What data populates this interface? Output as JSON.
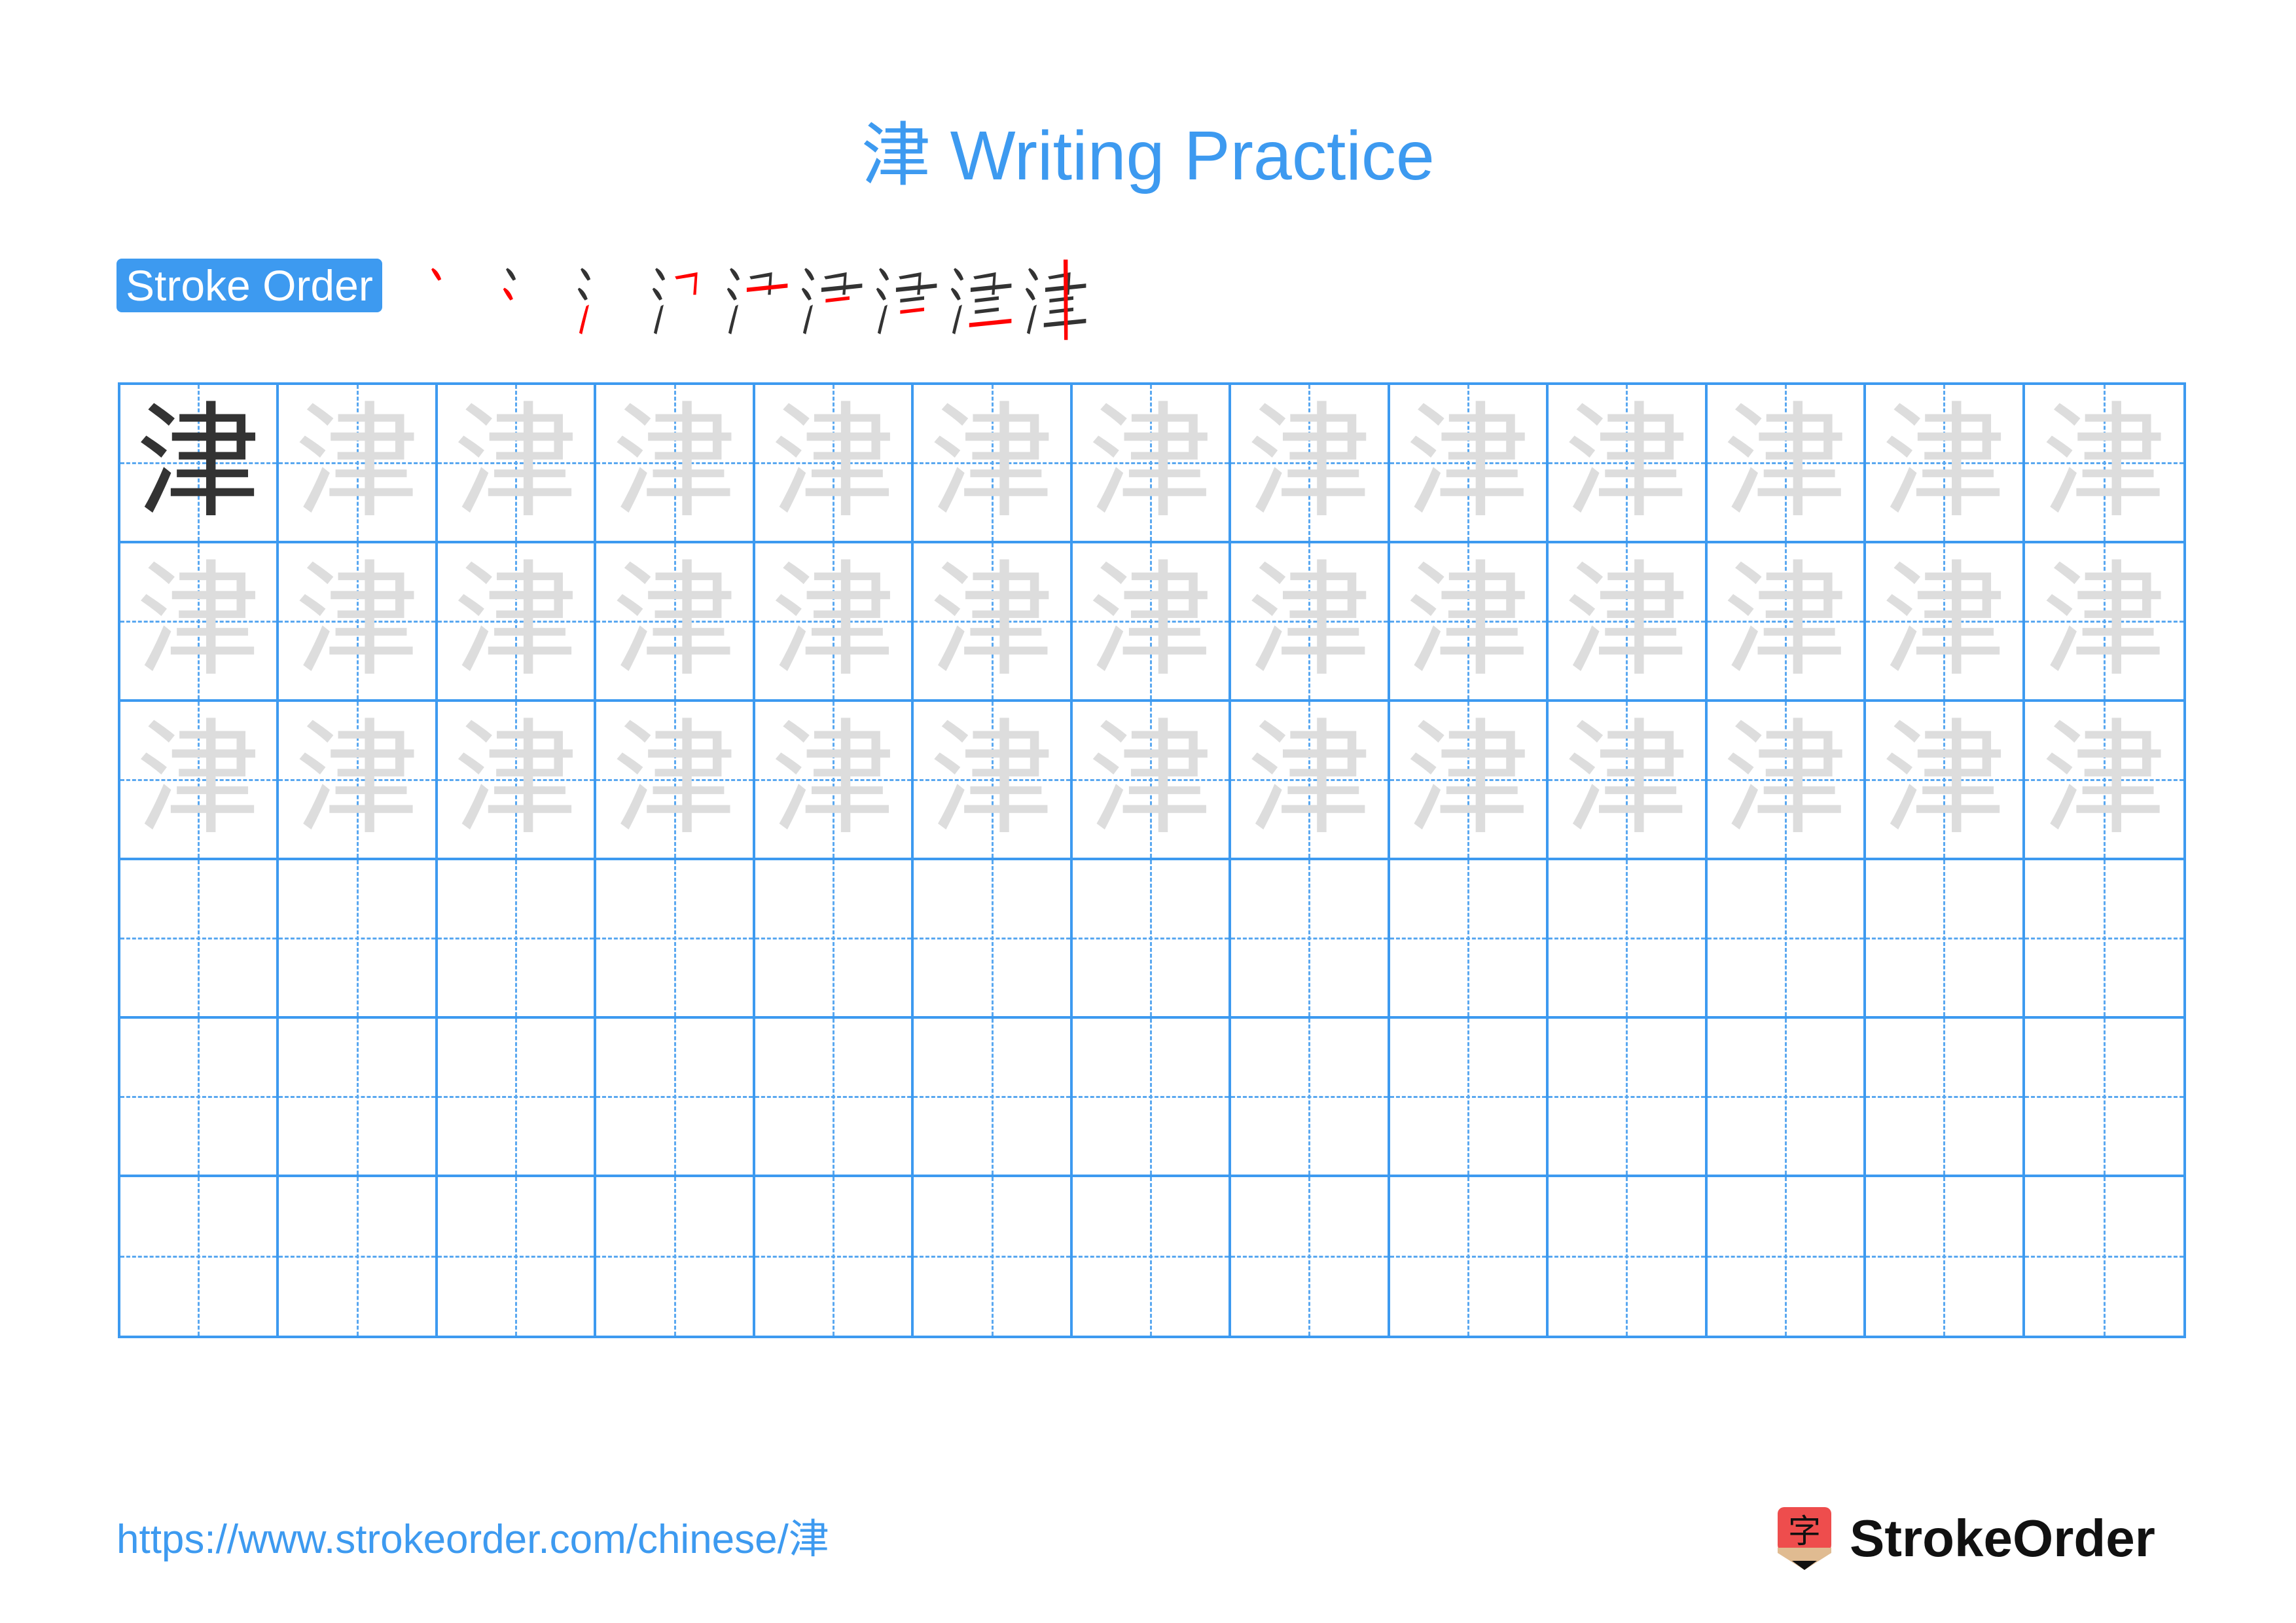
{
  "title": "津 Writing Practice",
  "character": "津",
  "stroke_order": {
    "label": "Stroke Order",
    "total_strokes": 9,
    "steps": [
      1,
      2,
      3,
      4,
      5,
      6,
      7,
      8,
      9
    ],
    "highlight_color": "#ff0000",
    "done_color": "#333333"
  },
  "grid": {
    "rows": 6,
    "columns": 13,
    "model_cells": 1,
    "trace_rows": 3,
    "blank_rows": 3,
    "line_color": "#3d9af0",
    "trace_color": "#dddddd"
  },
  "footer": {
    "url": "https://www.strokeorder.com/chinese/津",
    "logo_text": "StrokeOrder",
    "logo_glyph": "字"
  }
}
